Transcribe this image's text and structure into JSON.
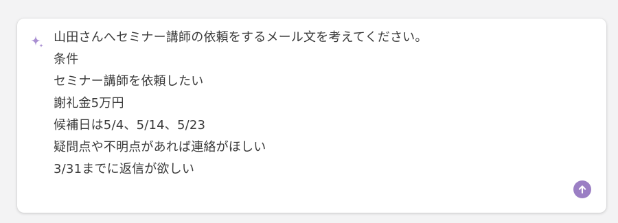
{
  "prompt": {
    "lines": [
      "山田さんへセミナー講師の依頼をするメール文を考えてください。",
      "条件",
      "セミナー講師を依頼したい",
      "謝礼金5万円",
      "候補日は5/4、5/14、5/23",
      "疑問点や不明点があれば連絡がほしい",
      "3/31までに返信が欲しい"
    ]
  },
  "icons": {
    "sparkle": "sparkle-icon",
    "send": "arrow-up-icon"
  },
  "colors": {
    "accent": "#9b7fc4",
    "text": "#3a3a3a",
    "background": "#f3f3f4",
    "card": "#ffffff"
  }
}
